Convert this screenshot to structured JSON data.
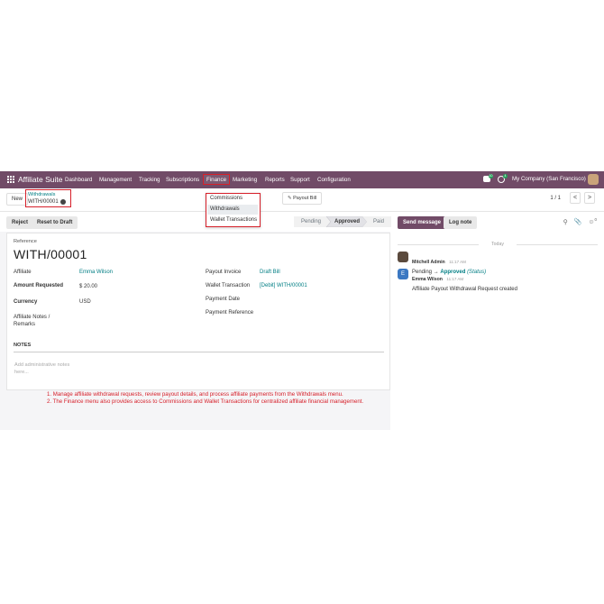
{
  "topnav": {
    "brand": "Affiliate Suite",
    "items": [
      "Dashboard",
      "Management",
      "Tracking",
      "Subscriptions",
      "Finance",
      "Marketing",
      "Reports",
      "Support",
      "Configuration"
    ],
    "chat_badge": "10",
    "activity_badge": "4",
    "company": "My Company (San Francisco)"
  },
  "control": {
    "new_label": "New",
    "breadcrumb_parent": "Withdrawals",
    "breadcrumb_current": "WITH/00001",
    "payout_bill_label": "Payout Bill",
    "pager": "1 / 1",
    "prev": "<",
    "next": ">"
  },
  "finance_menu": {
    "items": [
      "Commissions",
      "Withdrawals",
      "Wallet Transactions"
    ]
  },
  "statusbar": {
    "reject_label": "Reject",
    "reset_label": "Reset to Draft",
    "stages": [
      "Pending",
      "Approved",
      "Paid"
    ],
    "active_stage": "Approved",
    "send_message_label": "Send message",
    "log_note_label": "Log note",
    "attachment_count": "0"
  },
  "form": {
    "reference_label": "Reference",
    "reference_value": "WITH/00001",
    "affiliate_label": "Affiliate",
    "affiliate_value": "Emma Wilson",
    "amount_label": "Amount Requested",
    "amount_value": "$ 20.00",
    "currency_label": "Currency",
    "currency_value": "USD",
    "notes_remarks_label": "Affiliate Notes / Remarks",
    "payout_invoice_label": "Payout Invoice",
    "payout_invoice_value": "Draft Bill",
    "wallet_tx_label": "Wallet Transaction",
    "wallet_tx_value": "[Debit] WITH/00001",
    "payment_date_label": "Payment Date",
    "payment_ref_label": "Payment Reference",
    "notes_heading": "NOTES",
    "notes_placeholder": "Add administrative notes here..."
  },
  "chatter": {
    "day_label": "Today",
    "messages": [
      {
        "author": "Mitchell Admin",
        "time": "11:17 AM",
        "from": "Pending",
        "arrow": "→",
        "to": "Approved",
        "field": "(Status)"
      },
      {
        "author": "Emma Wilson",
        "time": "11:17 AM",
        "initial": "E",
        "body": "Affiliate Payout Withdrawal Request created"
      }
    ]
  },
  "captions": [
    "1. Manage affiliate withdrawal requests, review payout details, and process affiliate payments from the Withdrawals menu.",
    "2. The Finance menu also provides access to Commissions and Wallet Transactions for centralized affiliate financial management."
  ],
  "colors": {
    "brand": "#714b67",
    "link": "#017e84",
    "highlight": "#d6202a"
  }
}
